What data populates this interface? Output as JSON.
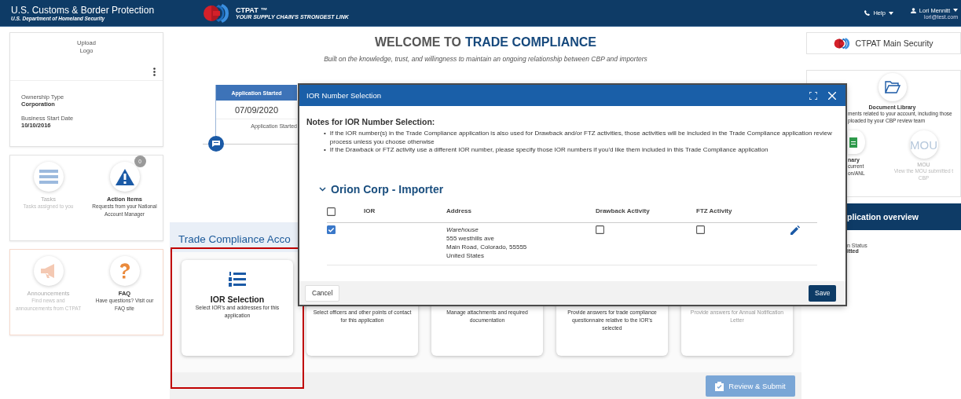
{
  "header": {
    "agency": "U.S. Customs & Border Protection",
    "department": "U.S. Department of Homeland Security",
    "program": "CTPAT ™",
    "tagline": "YOUR SUPPLY CHAIN'S STRONGEST LINK",
    "help": "Help",
    "user_name": "Lori Mennitt",
    "user_email": "lori@test.com"
  },
  "profile": {
    "logo_placeholder": "Upload Logo",
    "fields": [
      {
        "label": "Ownership Type",
        "value": "Corporation"
      },
      {
        "label": "Business Start Date",
        "value": "10/10/2016"
      }
    ]
  },
  "quick_links": [
    {
      "kind": "list",
      "title": "Tasks",
      "description": "Tasks assigned to you",
      "disabled": true
    },
    {
      "kind": "warning",
      "title": "Action Items",
      "description": "Requests from your National Account Manager",
      "disabled": false,
      "badge": "0"
    }
  ],
  "help_links": [
    {
      "kind": "megaphone",
      "title": "Announcements",
      "description": "Find news and announcements from CTPAT",
      "disabled": true
    },
    {
      "kind": "question",
      "title": "FAQ",
      "description": "Have questions? Visit our FAQ site",
      "disabled": false
    }
  ],
  "welcome": {
    "title_lead": "WELCOME TO",
    "title_highlight": "TRADE COMPLIANCE",
    "subtitle": "Built on the knowledge, trust, and willingness to maintain an ongoing relationship between CBP and importers"
  },
  "timeline": {
    "label": "Application Started",
    "date": "07/09/2020",
    "status": "Application Started"
  },
  "section": {
    "title": "Trade Compliance Acco",
    "cards": [
      {
        "kind": "numbered-list",
        "title": "IOR Selection",
        "description": "Select IOR's and addresses for this application",
        "highlighted": true,
        "disabled": false
      },
      {
        "kind": "hidden",
        "description": "Select officers and other points of contact for this application",
        "highlighted": false,
        "disabled": false
      },
      {
        "kind": "hidden",
        "description": "Manage attachments and required documentation",
        "highlighted": false,
        "disabled": false
      },
      {
        "kind": "hidden",
        "description": "Provide answers for trade compliance questionnaire relative to the IOR's selected",
        "highlighted": false,
        "disabled": false
      },
      {
        "kind": "hidden",
        "description": "Provide answers for Annual Notification Letter",
        "highlighted": false,
        "disabled": true
      }
    ]
  },
  "review_button": {
    "label": "Review & Submit",
    "disabled": true
  },
  "right_panel": {
    "main_security": "CTPAT Main Security",
    "document_library": {
      "title": "Document Library",
      "description_lines": [
        "ments related to your account, including those",
        "ploaded by your CBP review team"
      ]
    },
    "tiles": [
      {
        "kind": "summary",
        "title": "nary",
        "description_lines": [
          "current",
          "on/ANL"
        ],
        "disabled": false
      },
      {
        "kind": "mou",
        "icon_text": "MOU",
        "title": "MOU",
        "description_lines": [
          "View the MOU submitted t",
          "CBP"
        ],
        "disabled": true
      }
    ],
    "overview_title": "plication overview",
    "status_label": "n Status",
    "status_value": "itted"
  },
  "modal": {
    "title": "IOR Number Selection",
    "notes_title": "Notes for IOR Number Selection:",
    "note_marker": "•",
    "notes": [
      "If the IOR number(s) in the Trade Compliance application is also used for Drawback and/or FTZ activities, those activities will be included in the Trade Compliance application review process unless you choose otherwise",
      "If the Drawback or FTZ activity use a different IOR number, please specify those IOR numbers if you'd like them included in this Trade Compliance application"
    ],
    "group": {
      "name": "Orion Corp - Importer",
      "expanded": true,
      "select_all": false,
      "columns": [
        "IOR",
        "Address",
        "Drawback Activity",
        "FTZ Activity"
      ],
      "rows": [
        {
          "selected": true,
          "address_name": "Warehouse",
          "address_lines": [
            "555 westhills ave",
            "Main Road, Colorado, 55555",
            "United States"
          ],
          "drawback": false,
          "ftz": false
        }
      ]
    },
    "cancel": "Cancel",
    "save": "Save"
  }
}
